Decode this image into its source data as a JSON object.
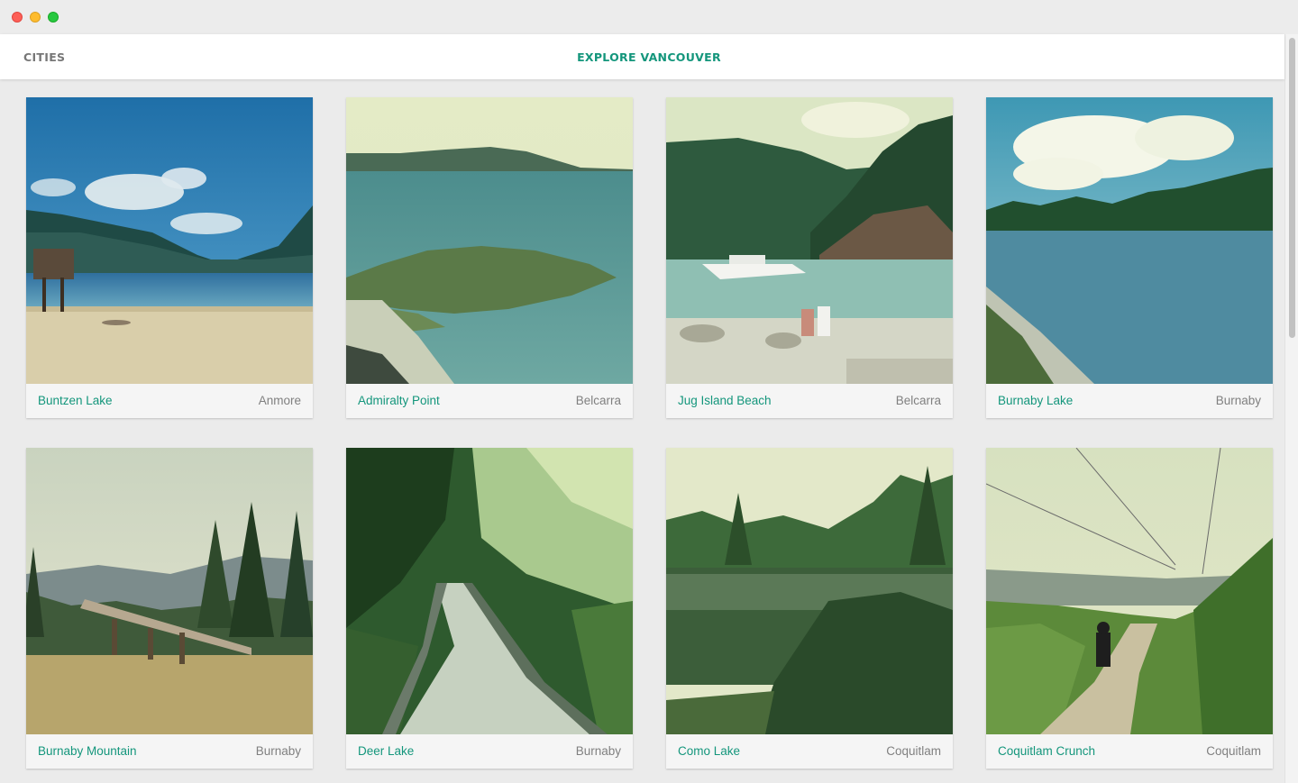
{
  "window": {
    "controls": [
      "close",
      "minimize",
      "zoom"
    ]
  },
  "nav": {
    "left_label": "CITIES",
    "title": "EXPLORE VANCOUVER"
  },
  "cards": [
    {
      "place": "Buntzen Lake",
      "city": "Anmore",
      "photo": "lake-beach-photo"
    },
    {
      "place": "Admiralty Point",
      "city": "Belcarra",
      "photo": "shoreline-photo"
    },
    {
      "place": "Jug Island Beach",
      "city": "Belcarra",
      "photo": "beach-boat-photo"
    },
    {
      "place": "Burnaby Lake",
      "city": "Burnaby",
      "photo": "lake-forest-photo"
    },
    {
      "place": "Burnaby Mountain",
      "city": "Burnaby",
      "photo": "mountain-park-photo"
    },
    {
      "place": "Deer Lake",
      "city": "Burnaby",
      "photo": "boardwalk-forest-photo"
    },
    {
      "place": "Como Lake",
      "city": "Coquitlam",
      "photo": "pond-reflection-photo"
    },
    {
      "place": "Coquitlam Crunch",
      "city": "Coquitlam",
      "photo": "trail-powerlines-photo"
    }
  ]
}
